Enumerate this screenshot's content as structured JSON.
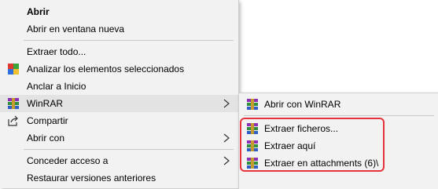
{
  "main_menu": {
    "items": [
      {
        "label": "Abrir"
      },
      {
        "label": "Abrir en ventana nueva"
      },
      {
        "label": "Extraer todo..."
      },
      {
        "label": "Analizar los elementos seleccionados"
      },
      {
        "label": "Anclar a Inicio"
      },
      {
        "label": "WinRAR"
      },
      {
        "label": "Compartir"
      },
      {
        "label": "Abrir con"
      },
      {
        "label": "Conceder acceso a"
      },
      {
        "label": "Restaurar versiones anteriores"
      }
    ]
  },
  "submenu": {
    "items": [
      {
        "label": "Abrir con WinRAR"
      },
      {
        "label": "Extraer ficheros..."
      },
      {
        "label": "Extraer aquí"
      },
      {
        "label": "Extraer en attachments (6)\\"
      }
    ]
  },
  "colors": {
    "highlight_box": "#e6323c",
    "menu_bg": "#f2f2f2",
    "hover_bg": "#e3e3e3"
  }
}
